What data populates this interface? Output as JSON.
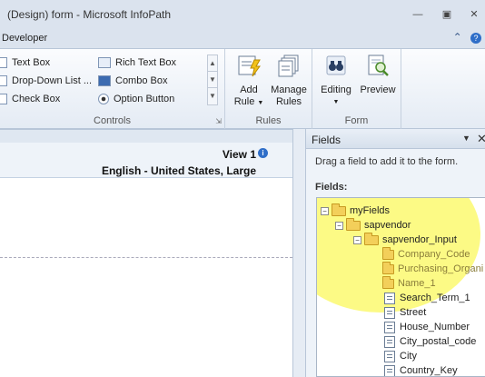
{
  "window": {
    "title": "(Design) form  -  Microsoft InfoPath"
  },
  "ribbon": {
    "active_tab": "Developer",
    "controls_group": {
      "label": "Controls",
      "items": [
        {
          "label": "Text Box",
          "icon": "text-box-icon"
        },
        {
          "label": "Rich Text Box",
          "icon": "rich-text-box-icon"
        },
        {
          "label": "Drop-Down List ...",
          "icon": "drop-down-list-icon"
        },
        {
          "label": "Combo Box",
          "icon": "combo-box-icon"
        },
        {
          "label": "Check Box",
          "icon": "check-box-icon"
        },
        {
          "label": "Option Button",
          "icon": "option-button-icon"
        }
      ]
    },
    "rules_group": {
      "label": "Rules",
      "add_rule": {
        "line1": "Add",
        "line2": "Rule"
      },
      "manage_rules": {
        "line1": "Manage",
        "line2": "Rules"
      }
    },
    "form_group": {
      "label": "Form",
      "editing": "Editing",
      "preview": "Preview"
    }
  },
  "document": {
    "view": "View 1",
    "language": "English - United States, Large"
  },
  "fields_pane": {
    "title": "Fields",
    "hint": "Drag a field to add it to the form.",
    "fields_label": "Fields:",
    "tree": [
      {
        "label": "myFields",
        "type": "group",
        "level": 0,
        "expanded": true
      },
      {
        "label": "sapvendor",
        "type": "group",
        "level": 1,
        "expanded": true
      },
      {
        "label": "sapvendor_Input",
        "type": "group",
        "level": 2,
        "expanded": true
      },
      {
        "label": "Company_Code",
        "type": "folder",
        "level": 3
      },
      {
        "label": "Purchasing_Organi",
        "type": "folder",
        "level": 3
      },
      {
        "label": "Name_1",
        "type": "folder",
        "level": 3
      },
      {
        "label": "Search_Term_1",
        "type": "field",
        "level": 3
      },
      {
        "label": "Street",
        "type": "field",
        "level": 3
      },
      {
        "label": "House_Number",
        "type": "field",
        "level": 3
      },
      {
        "label": "City_postal_code",
        "type": "field",
        "level": 3
      },
      {
        "label": "City",
        "type": "field",
        "level": 3
      },
      {
        "label": "Country_Key",
        "type": "field",
        "level": 3
      }
    ]
  },
  "colors": {
    "titlebar": "#dbe3ee",
    "highlight": "#fcf978",
    "folder": "#f3cf5a"
  }
}
